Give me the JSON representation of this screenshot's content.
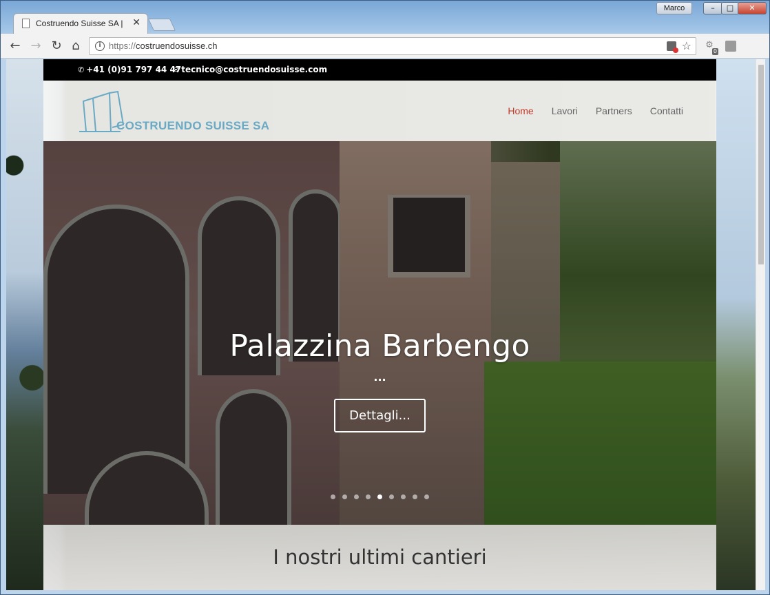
{
  "browser": {
    "tab_title": "Costruendo Suisse SA |",
    "tab_close": "✕",
    "user_name": "Marco",
    "url_scheme": "https://",
    "url_host": "costruendosuisse.ch",
    "ext_badge_count": "0",
    "win_min": "–",
    "win_max": "□",
    "win_close": "✕"
  },
  "site": {
    "topbar": {
      "phone": "+41 (0)91 797 44 47",
      "email": "tecnico@costruendosuisse.com"
    },
    "logo_text": "COSTRUENDO SUISSE SA",
    "menu": [
      "Home",
      "Lavori",
      "Partners",
      "Contatti"
    ],
    "active_menu": "Home",
    "hero": {
      "title": "Palazzina Barbengo",
      "subtitle": "...",
      "button_label": "Dettagli...",
      "slide_count": 9,
      "active_slide": 5
    },
    "section_title": "I nostri ultimi cantieri",
    "colors": {
      "accent_active": "#c0392b",
      "logo_blue": "#6aa9c4",
      "topbar_bg": "#000000"
    }
  }
}
